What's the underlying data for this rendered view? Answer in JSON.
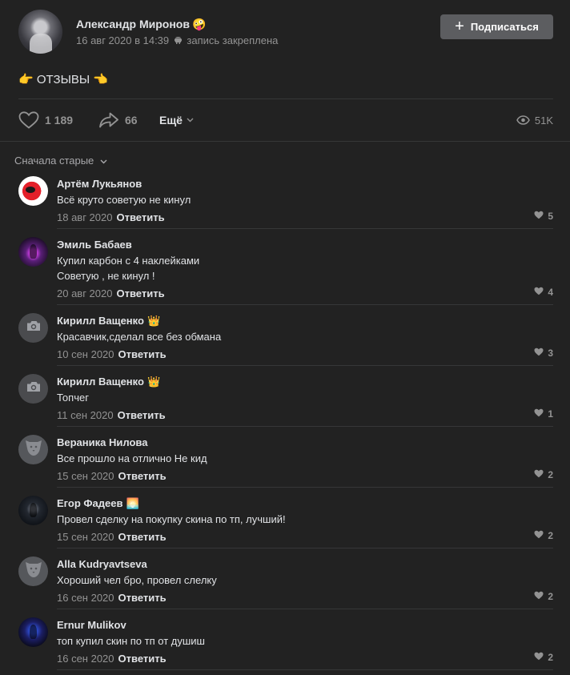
{
  "post": {
    "author": "Александр Миронов",
    "author_emoji": "🤪",
    "date": "16 авг 2020 в 14:39",
    "pinned_text": "запись закреплена",
    "subscribe_label": "Подписаться",
    "text": "👉 ОТЗЫВЫ 👈",
    "likes": "1 189",
    "shares": "66",
    "more_label": "Ещё",
    "views": "51K"
  },
  "sort_label": "Сначала старые",
  "reply_label": "Ответить",
  "comments": [
    {
      "author": "Артём Лукьянов",
      "badge": "",
      "lines": [
        "Всё круто советую не кинул"
      ],
      "date": "18 авг 2020",
      "likes": "5",
      "avatar": "red"
    },
    {
      "author": "Эмиль Бабаев",
      "badge": "",
      "lines": [
        "Купил карбон с 4 наклейками",
        "Советую , не кинул !"
      ],
      "date": "20 авг 2020",
      "likes": "4",
      "avatar": "purple"
    },
    {
      "author": "Кирилл Ващенко",
      "badge": "👑",
      "lines": [
        "Красавчик,сделал все без обмана"
      ],
      "date": "10 сен 2020",
      "likes": "3",
      "avatar": "camera-icon"
    },
    {
      "author": "Кирилл Ващенко",
      "badge": "👑",
      "lines": [
        "Топчег"
      ],
      "date": "11 сен 2020",
      "likes": "1",
      "avatar": "camera-icon"
    },
    {
      "author": "Вераника Нилова",
      "badge": "",
      "lines": [
        "Все прошло на отлично Не кид"
      ],
      "date": "15 сен 2020",
      "likes": "2",
      "avatar": "dog-icon"
    },
    {
      "author": "Егор Фадеев",
      "badge": "🌅",
      "lines": [
        "Провел сделку на покупку скина по тп, лучший!"
      ],
      "date": "15 сен 2020",
      "likes": "2",
      "avatar": "dark"
    },
    {
      "author": "Alla Kudryavtseva",
      "badge": "",
      "lines": [
        "Хороший чел бро, провел слелку"
      ],
      "date": "16 сен 2020",
      "likes": "2",
      "avatar": "dog-icon"
    },
    {
      "author": "Ernur Mulikov",
      "badge": "",
      "lines": [
        "топ купил скин по тп от душиш"
      ],
      "date": "16 сен 2020",
      "likes": "2",
      "avatar": "neon"
    }
  ]
}
